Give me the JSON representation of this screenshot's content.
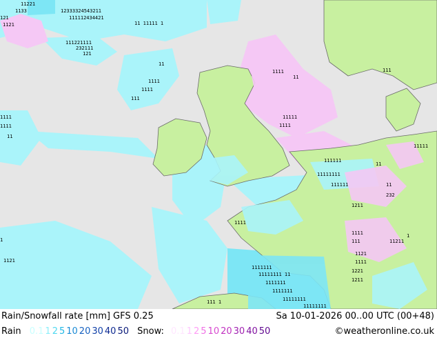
{
  "title": "Rain/Snowfall rate [mm] GFS 0.25",
  "datetime": "Sa 10-01-2026 00..00 UTC (00+48)",
  "rain_label": "Rain",
  "snow_label": "Snow:",
  "credit": "©weatheronline.co.uk",
  "rain_legend": [
    {
      "v": "0.1",
      "c": "#c8ffff"
    },
    {
      "v": "1",
      "c": "#8ceefa"
    },
    {
      "v": "2",
      "c": "#4fd8f0"
    },
    {
      "v": "5",
      "c": "#1fb8e6"
    },
    {
      "v": "10",
      "c": "#1a8ad4"
    },
    {
      "v": "20",
      "c": "#1560c0"
    },
    {
      "v": "30",
      "c": "#1040a8"
    },
    {
      "v": "40",
      "c": "#0c2890"
    },
    {
      "v": "50",
      "c": "#081878"
    }
  ],
  "snow_legend": [
    {
      "v": "0.1",
      "c": "#ffe6ff"
    },
    {
      "v": "1",
      "c": "#ffc8ff"
    },
    {
      "v": "2",
      "c": "#ff9cf5"
    },
    {
      "v": "5",
      "c": "#f070e6"
    },
    {
      "v": "10",
      "c": "#d84ad0"
    },
    {
      "v": "20",
      "c": "#c030c0"
    },
    {
      "v": "30",
      "c": "#a020b0"
    },
    {
      "v": "40",
      "c": "#8010a0"
    },
    {
      "v": "50",
      "c": "#600890"
    }
  ],
  "colors": {
    "sea": "#e6e6e6",
    "land": "#c8f0a0",
    "rain_light": "#aaf4fa",
    "rain_mid": "#7de6f5",
    "snow_light": "#f5c8f5",
    "coast": "#6a6a6a"
  }
}
